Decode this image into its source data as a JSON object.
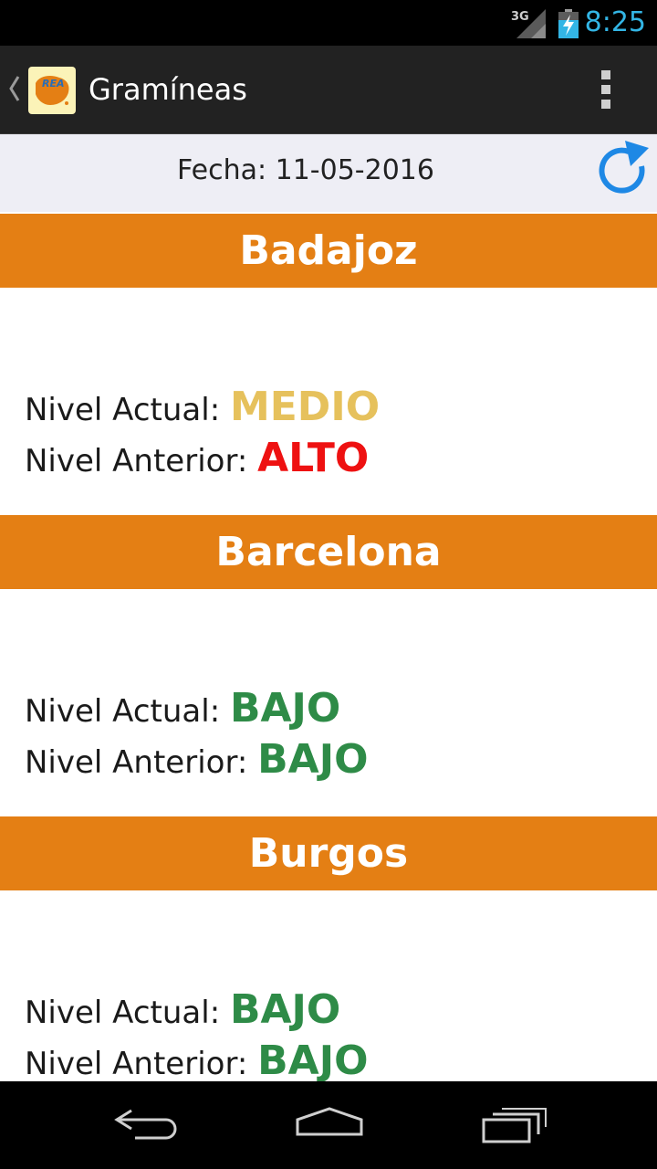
{
  "status_bar": {
    "network": "3G",
    "time": "8:25",
    "clock_color": "#33b5e5"
  },
  "action_bar": {
    "title": "Gramíneas",
    "logo_text": "REA",
    "icons": [
      "up-caret-icon",
      "rea-logo-icon",
      "overflow-menu-icon"
    ]
  },
  "date_bar": {
    "label": "Fecha: 11-05-2016",
    "refresh_icon": "refresh-icon",
    "refresh_color": "#1e88e5"
  },
  "labels": {
    "current": "Nivel Actual:",
    "previous": "Nivel Anterior:"
  },
  "colors": {
    "header_bg": "#e47f14",
    "medio": "#e6c15c",
    "alto": "#ee1111",
    "bajo": "#2e8b47"
  },
  "cities": [
    {
      "name": "Badajoz",
      "current": "MEDIO",
      "previous": "ALTO"
    },
    {
      "name": "Barcelona",
      "current": "BAJO",
      "previous": "BAJO"
    },
    {
      "name": "Burgos",
      "current": "BAJO",
      "previous": "BAJO"
    }
  ],
  "nav_bar": {
    "icons": [
      "back-icon",
      "home-icon",
      "recent-apps-icon"
    ]
  }
}
